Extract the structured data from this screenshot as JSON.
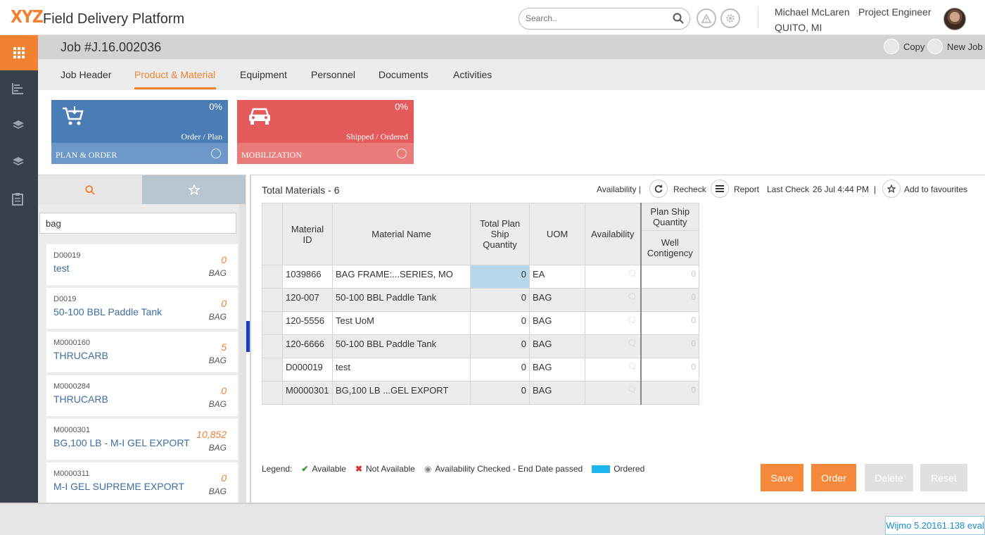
{
  "header": {
    "logo": "XYZ",
    "app_title": "Field Delivery Platform",
    "search_placeholder": "Search..",
    "user_name": "Michael McLaren",
    "user_role": "Project Engineer",
    "user_location": "QUITO, MI"
  },
  "jobbar": {
    "title": "Job #J.16.002036",
    "copy_label": "Copy",
    "new_job_label": "New Job"
  },
  "tabs": [
    "Job Header",
    "Product & Material",
    "Equipment",
    "Personnel",
    "Documents",
    "Activities"
  ],
  "active_tab": "Product & Material",
  "tiles": {
    "plan": {
      "pct": "0%",
      "sub": "Order / Plan",
      "label": "PLAN & ORDER",
      "color": "#4a7db5"
    },
    "mob": {
      "pct": "0%",
      "sub": "Shipped / Ordered",
      "label": "MOBILIZATION",
      "color": "#e45a5a"
    }
  },
  "left": {
    "search_value": "bag",
    "items": [
      {
        "code": "D00019",
        "name": "test",
        "qty": "0",
        "uom": "BAG"
      },
      {
        "code": "D0019",
        "name": "50-100 BBL Paddle Tank",
        "qty": "0",
        "uom": "BAG"
      },
      {
        "code": "M0000160",
        "name": "THRUCARB",
        "qty": "5",
        "uom": "BAG"
      },
      {
        "code": "M0000284",
        "name": "THRUCARB",
        "qty": "0",
        "uom": "BAG"
      },
      {
        "code": "M0000301",
        "name": "BG,100 LB - M-I GEL EXPORT",
        "qty": "10,852",
        "uom": "BAG"
      },
      {
        "code": "M0000311",
        "name": "M-I GEL SUPREME EXPORT",
        "qty": "0",
        "uom": "BAG"
      }
    ]
  },
  "main": {
    "title": "Total Materials - 6",
    "availability_label": "Availability |",
    "recheck_label": "Recheck",
    "report_label": "Report",
    "last_check_label": "Last Check",
    "last_check_value": "26 Jul 4:44 PM",
    "sep": "|",
    "favourites_label": "Add to favourites",
    "columns": {
      "material_id": "Material ID",
      "material_name": "Material Name",
      "total_plan": "Total Plan Ship Quantity",
      "uom": "UOM",
      "availability": "Availability",
      "plan_ship": "Plan Ship Quantity",
      "well": "Well Contigency"
    },
    "rows": [
      {
        "id": "1039866",
        "name": "BAG FRAME:...SERIES, MO",
        "qty": "0",
        "uom": "EA",
        "wc": "0"
      },
      {
        "id": "120-007",
        "name": "50-100 BBL Paddle Tank",
        "qty": "0",
        "uom": "BAG",
        "wc": "0"
      },
      {
        "id": "120-5556",
        "name": "Test UoM",
        "qty": "0",
        "uom": "BAG",
        "wc": "0"
      },
      {
        "id": "120-6666",
        "name": "50-100 BBL Paddle Tank",
        "qty": "0",
        "uom": "BAG",
        "wc": "0"
      },
      {
        "id": "D000019",
        "name": "test",
        "qty": "0",
        "uom": "BAG",
        "wc": "0"
      },
      {
        "id": "M0000301",
        "name": "BG,100 LB ...GEL EXPORT",
        "qty": "0",
        "uom": "BAG",
        "wc": "0"
      }
    ]
  },
  "legend": {
    "title": "Legend:",
    "available": "Available",
    "not_available": "Not Available",
    "checked": "Availability Checked - End Date passed",
    "ordered": "Ordered"
  },
  "buttons": {
    "save": "Save",
    "order": "Order",
    "delete": "Delete",
    "reset": "Reset"
  },
  "footer": {
    "wijmo": "Wijmo 5.20161.138 eval"
  }
}
